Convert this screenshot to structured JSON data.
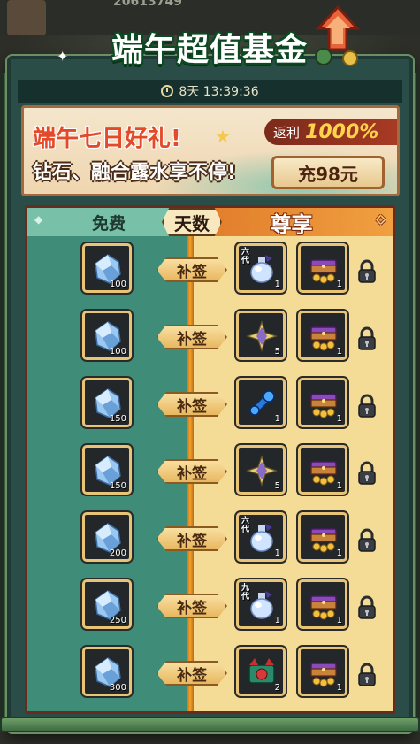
{
  "header": {
    "top_number": "20613749",
    "title": "端午超值基金",
    "timer": "8天 13:39:36"
  },
  "banner": {
    "title": "端午七日好礼!",
    "subtitle": "钻石、融合露水享不停!",
    "rebate_label": "返利",
    "rebate_value": "1000%",
    "recharge_label": "充98元"
  },
  "board": {
    "free_header": "免费",
    "days_header": "天数",
    "vip_header": "尊享",
    "makeup_label": "补签",
    "rows": [
      {
        "free_qty": "100",
        "v1_icon": "potion-icon",
        "v1_tag": "六代",
        "v1_qty": "1",
        "v2_icon": "treasure-chest-icon",
        "v2_qty": "1"
      },
      {
        "free_qty": "100",
        "v1_icon": "star-shard-icon",
        "v1_tag": "",
        "v1_qty": "5",
        "v2_icon": "treasure-chest-icon",
        "v2_qty": "1"
      },
      {
        "free_qty": "150",
        "v1_icon": "blue-key-icon",
        "v1_tag": "",
        "v1_qty": "1",
        "v2_icon": "treasure-chest-icon",
        "v2_qty": "1"
      },
      {
        "free_qty": "150",
        "v1_icon": "star-shard-icon",
        "v1_tag": "",
        "v1_qty": "5",
        "v2_icon": "treasure-chest-icon",
        "v2_qty": "1"
      },
      {
        "free_qty": "200",
        "v1_icon": "potion-icon",
        "v1_tag": "六代",
        "v1_qty": "1",
        "v2_icon": "treasure-chest-icon",
        "v2_qty": "1"
      },
      {
        "free_qty": "250",
        "v1_icon": "potion-icon",
        "v1_tag": "九代",
        "v1_qty": "1",
        "v2_icon": "treasure-chest-icon",
        "v2_qty": "1"
      },
      {
        "free_qty": "300",
        "v1_icon": "dragon-chest-icon",
        "v1_tag": "",
        "v1_qty": "2",
        "v2_icon": "treasure-chest-icon",
        "v2_qty": "1"
      }
    ]
  },
  "colors": {
    "free_column": "#3f8c78",
    "vip_column": "#f4dc96",
    "accent": "#f5a228",
    "banner_title": "#e24a2a"
  }
}
